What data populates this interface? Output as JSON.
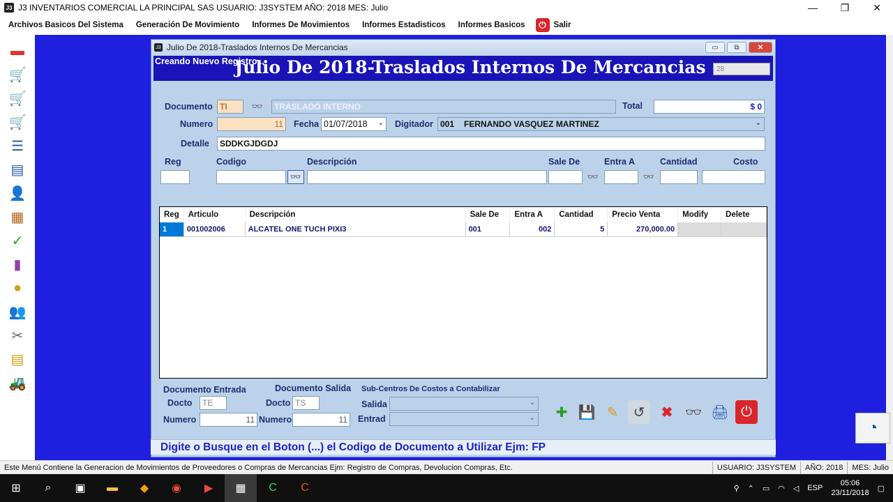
{
  "window": {
    "title": "J3 INVENTARIOS COMERCIAL LA PRINCIPAL SAS USUARIO: J3SYSTEM AÑO: 2018 MES: Julio",
    "app_icon": "J3",
    "minimize": "—",
    "maximize": "❐",
    "close": "✕"
  },
  "menu": {
    "items": [
      "Archivos Basicos Del Sistema",
      "Generación De Movimiento",
      "Informes De Movimientos",
      "Informes Estadisticos",
      "Informes Basicos"
    ],
    "exit_label": "Salir"
  },
  "child": {
    "title": "Julio De 2018-Traslados Internos De Mercancias",
    "creating_label": "Creando Nuevo Registro...",
    "banner_title": "Julio De 2018-Traslados Internos De Mercancias",
    "banner_number": "28"
  },
  "form": {
    "documento_label": "Documento",
    "documento_value": "TI",
    "documento_desc": "TRASLADO INTERNO",
    "total_label": "Total",
    "total_value": "$ 0",
    "numero_label": "Numero",
    "numero_value": "11",
    "fecha_label": "Fecha",
    "fecha_value": "01/07/2018",
    "digitador_label": "Digitador",
    "digitador_code": "001",
    "digitador_name": "FERNANDO VASQUEZ MARTINEZ",
    "detalle_label": "Detalle",
    "detalle_value": "SDDKGJDGDJ",
    "entry_labels": {
      "reg": "Reg",
      "codigo": "Codigo",
      "descripcion": "Descripción",
      "sale_de": "Sale De",
      "entra_a": "Entra A",
      "cantidad": "Cantidad",
      "costo": "Costo"
    }
  },
  "grid": {
    "columns": [
      "Reg",
      "Articulo",
      "Descripción",
      "Sale De",
      "Entra A",
      "Cantidad",
      "Precio Venta",
      "Modify",
      "Delete"
    ],
    "rows": [
      {
        "reg": "1",
        "articulo": "001002006",
        "descripcion": "ALCATEL ONE TUCH PIXI3",
        "sale_de": "001",
        "entra_a": "002",
        "cantidad": "5",
        "precio": "270,000.00"
      }
    ]
  },
  "bottom": {
    "doc_entrada_label": "Documento Entrada",
    "doc_salida_label": "Documento Salida",
    "docto_label": "Docto",
    "numero_label": "Numero",
    "entrada_docto": "TE",
    "entrada_numero": "11",
    "salida_docto": "TS",
    "salida_numero": "11",
    "subcentros_label": "Sub-Centros De Costos a Contabilizar",
    "salida_label": "Salida",
    "entrad_label": "Entrad"
  },
  "message": "Digite o Busque en el Boton (...) el Codigo de Documento a Utilizar Ejm: FP",
  "status": {
    "main": "Este Menú Contiene la Generacion de Movimientos de Proveedores o Compras de Mercancias Ejm: Registro de Compras, Devolucion Compras, Etc.",
    "usuario": "USUARIO: J3SYSTEM",
    "anio": "AÑO: 2018",
    "mes": "MES: Julio"
  },
  "taskbar": {
    "lang": "ESP",
    "time": "05:06",
    "date": "23/11/2018"
  },
  "colors": {
    "workspace": "#1f1fe0",
    "banner": "#1a14b8",
    "message_text": "#1a25c7"
  }
}
